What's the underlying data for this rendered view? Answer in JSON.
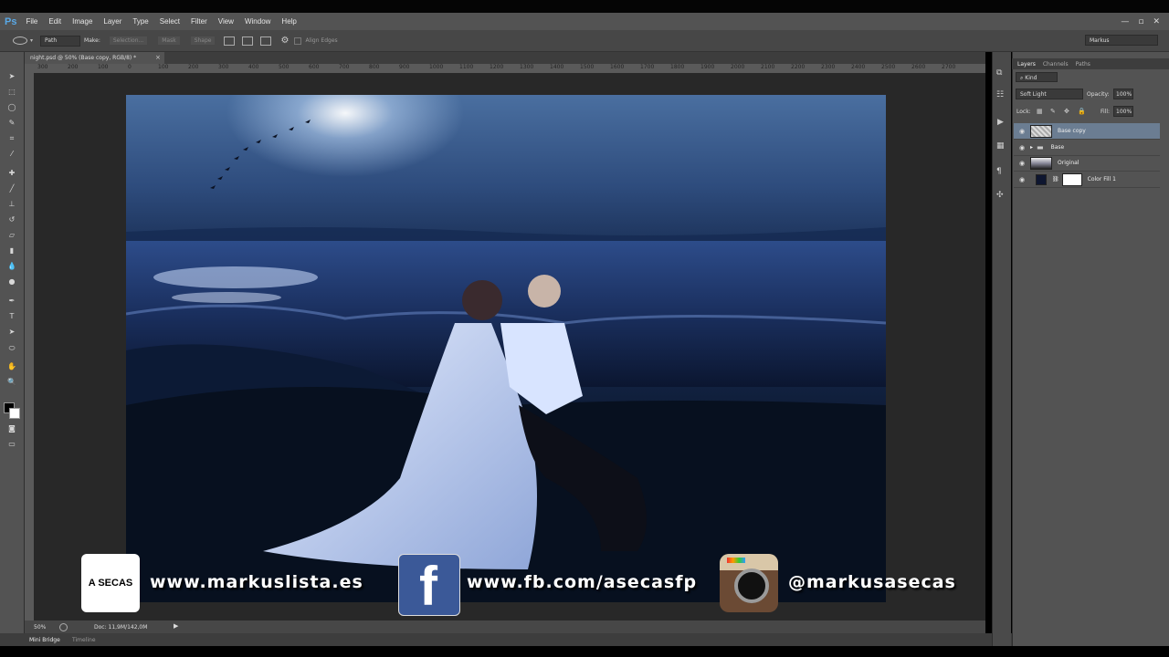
{
  "app": {
    "logo": "Ps",
    "window_controls": [
      "—",
      "▫",
      "✕"
    ]
  },
  "menu": [
    "File",
    "Edit",
    "Image",
    "Layer",
    "Type",
    "Select",
    "Filter",
    "View",
    "Window",
    "Help"
  ],
  "options": {
    "mode": "Path",
    "make_label": "Make:",
    "selection_btn": "Selection...",
    "mask_btn": "Mask",
    "shape_btn": "Shape",
    "align_edges": "Align Edges",
    "workspace": "Markus"
  },
  "document": {
    "tab_title": "night.psd @ 50% (Base copy, RGB/8) *"
  },
  "ruler_h": [
    "300",
    "200",
    "100",
    "0",
    "100",
    "200",
    "300",
    "400",
    "500",
    "600",
    "700",
    "800",
    "900",
    "1000",
    "1100",
    "1200",
    "1300",
    "1400",
    "1500",
    "1600",
    "1700",
    "1800",
    "1900",
    "2000",
    "2100",
    "2200",
    "2300",
    "2400",
    "2500",
    "2600",
    "2700"
  ],
  "status": {
    "zoom": "50%",
    "doc": "Doc: 11,9M/142,0M"
  },
  "bottom_tabs": [
    "Mini Bridge",
    "Timeline"
  ],
  "layers_panel": {
    "tabs": [
      "Layers",
      "Channels",
      "Paths"
    ],
    "filter": "Kind",
    "blend_mode": "Soft Light",
    "opacity_label": "Opacity:",
    "opacity": "100%",
    "lock_label": "Lock:",
    "fill_label": "Fill:",
    "fill": "100%",
    "layers": [
      {
        "name": "Base copy",
        "selected": true
      },
      {
        "name": "Base",
        "selected": false
      },
      {
        "name": "Original",
        "selected": false
      },
      {
        "name": "Color Fill 1",
        "selected": false
      }
    ]
  },
  "promo": {
    "logo_text": "A SECAS",
    "website": "www.markuslista.es",
    "facebook": "www.fb.com/asecasfp",
    "instagram": "@markusasecas",
    "fb_letter": "f"
  },
  "colors": {
    "ui_bg": "#535353",
    "canvas_bg": "#282828",
    "selected_layer": "#6b7d92",
    "ps_blue": "#5aa9e6",
    "facebook_blue": "#3b5998"
  }
}
